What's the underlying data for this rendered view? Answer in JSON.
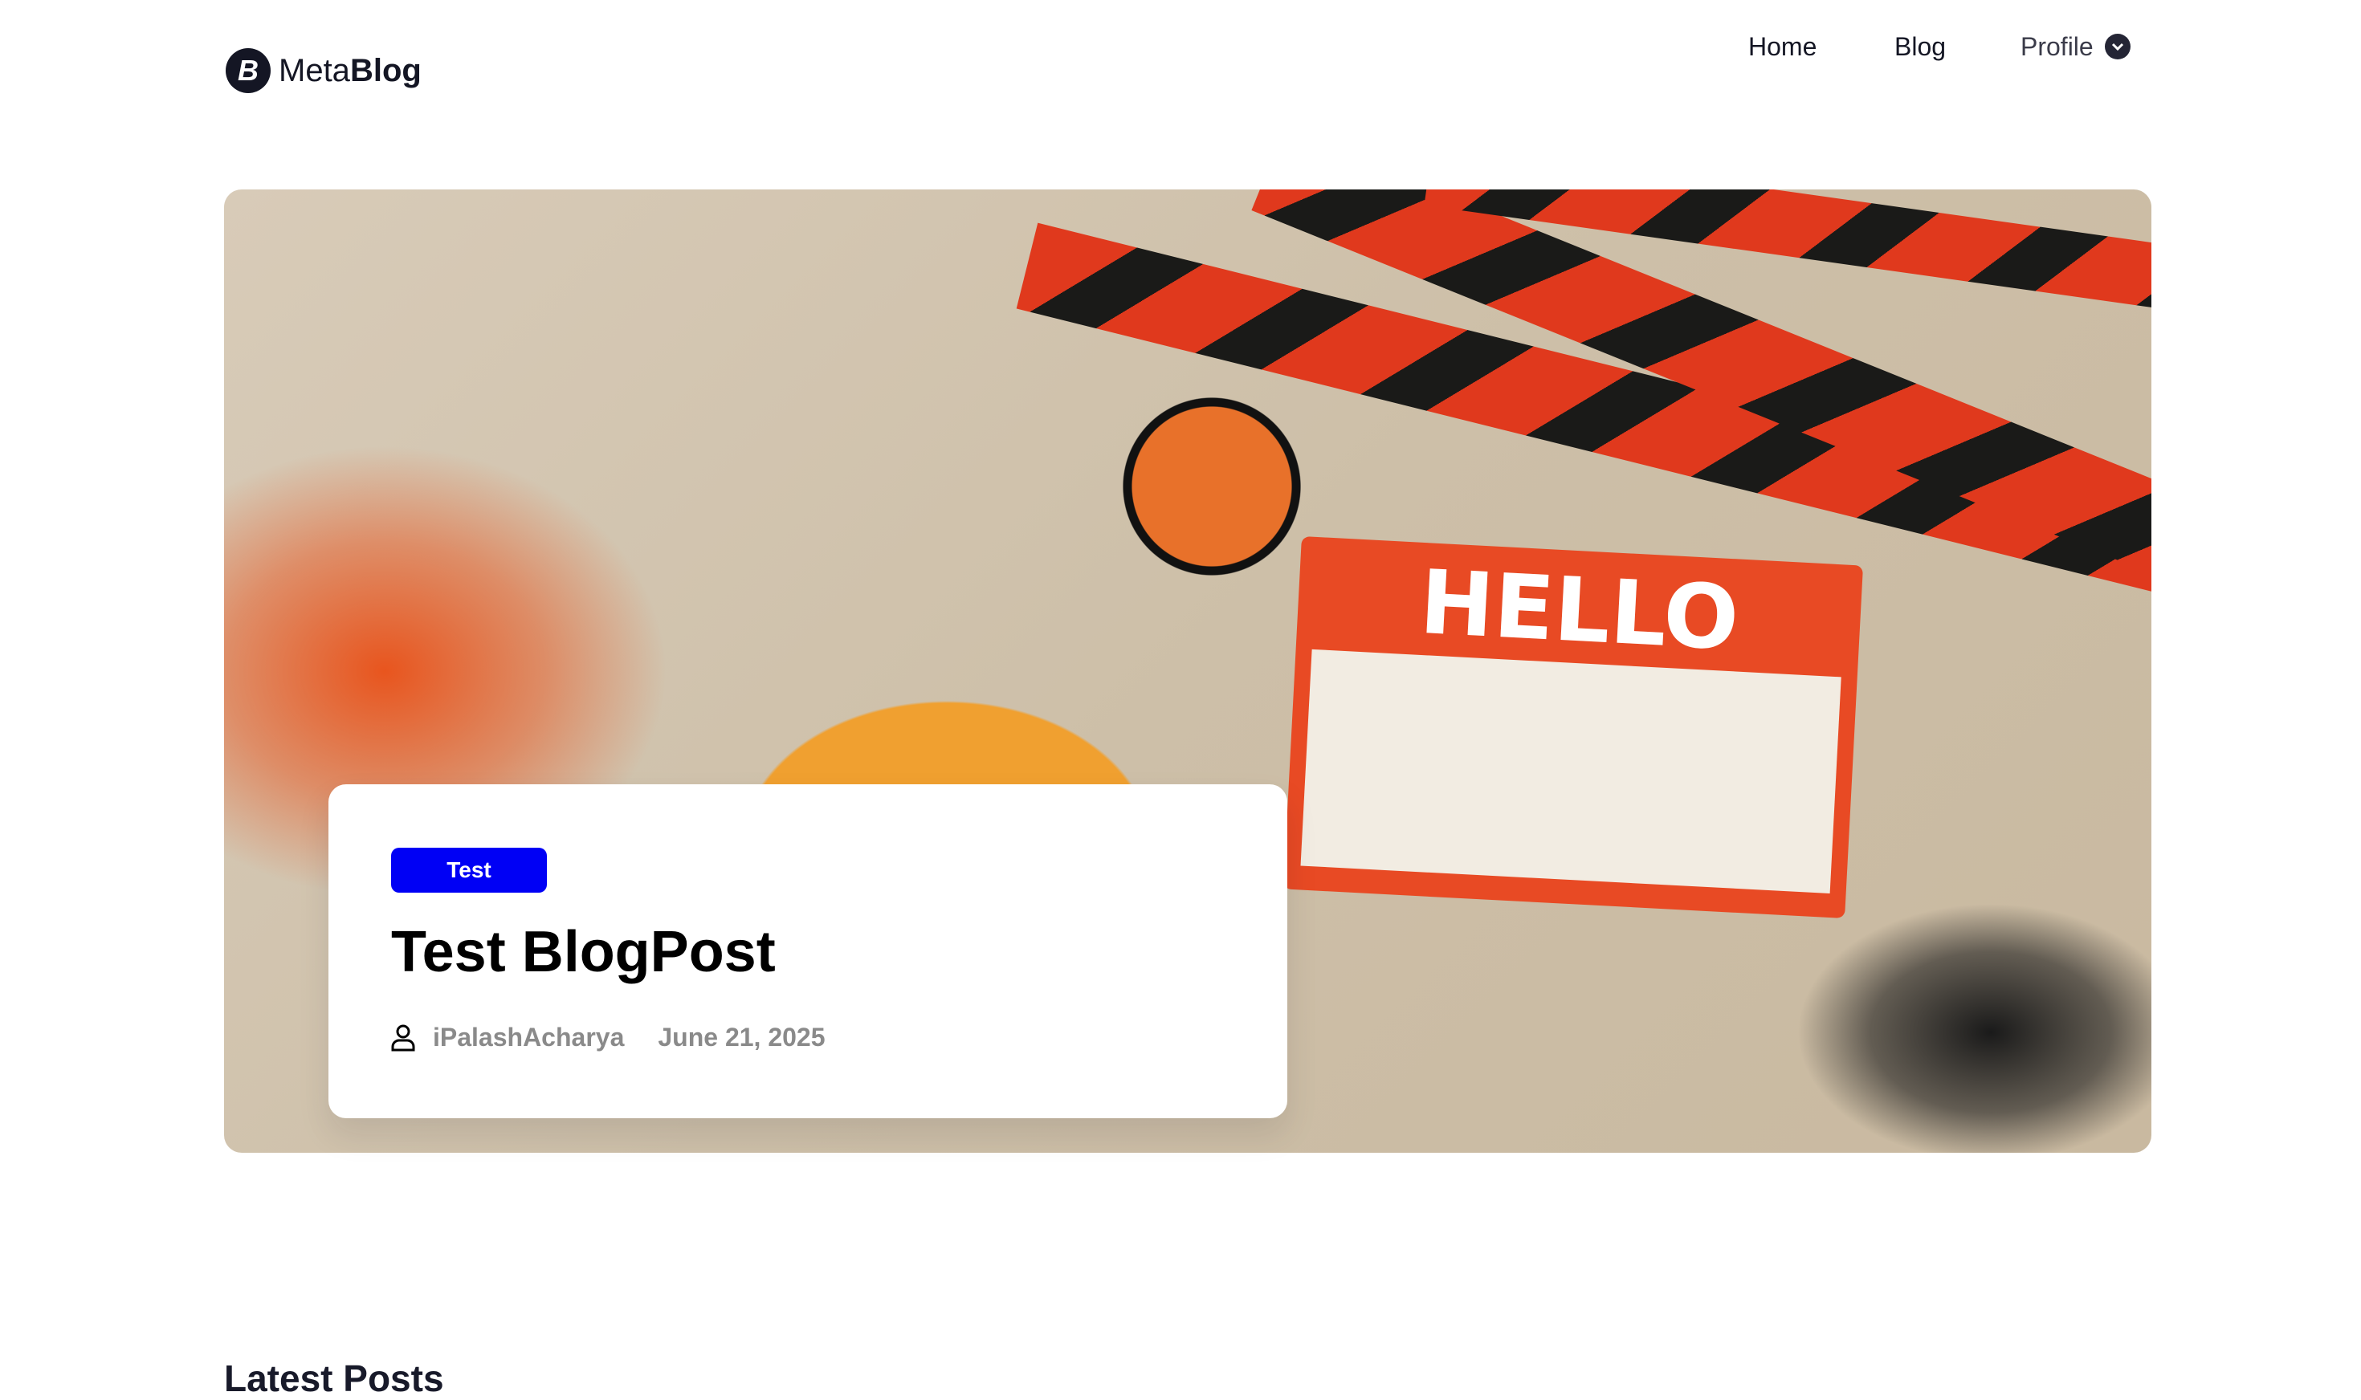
{
  "header": {
    "logo": {
      "prefix": "Meta",
      "suffix": "Blog",
      "icon": "b-logo-icon"
    },
    "nav": [
      {
        "label": "Home"
      },
      {
        "label": "Blog"
      },
      {
        "label": "Profile",
        "icon": "chevron-down-icon"
      }
    ]
  },
  "hero": {
    "image_text": {
      "hello": "HELLO"
    },
    "card": {
      "badge": "Test",
      "badge_color": "#0000F5",
      "title": "Test BlogPost",
      "author": "iPalashAcharya",
      "author_icon": "user-icon",
      "date": "June 21, 2025"
    }
  },
  "sections": {
    "latest_title": "Latest Posts"
  }
}
